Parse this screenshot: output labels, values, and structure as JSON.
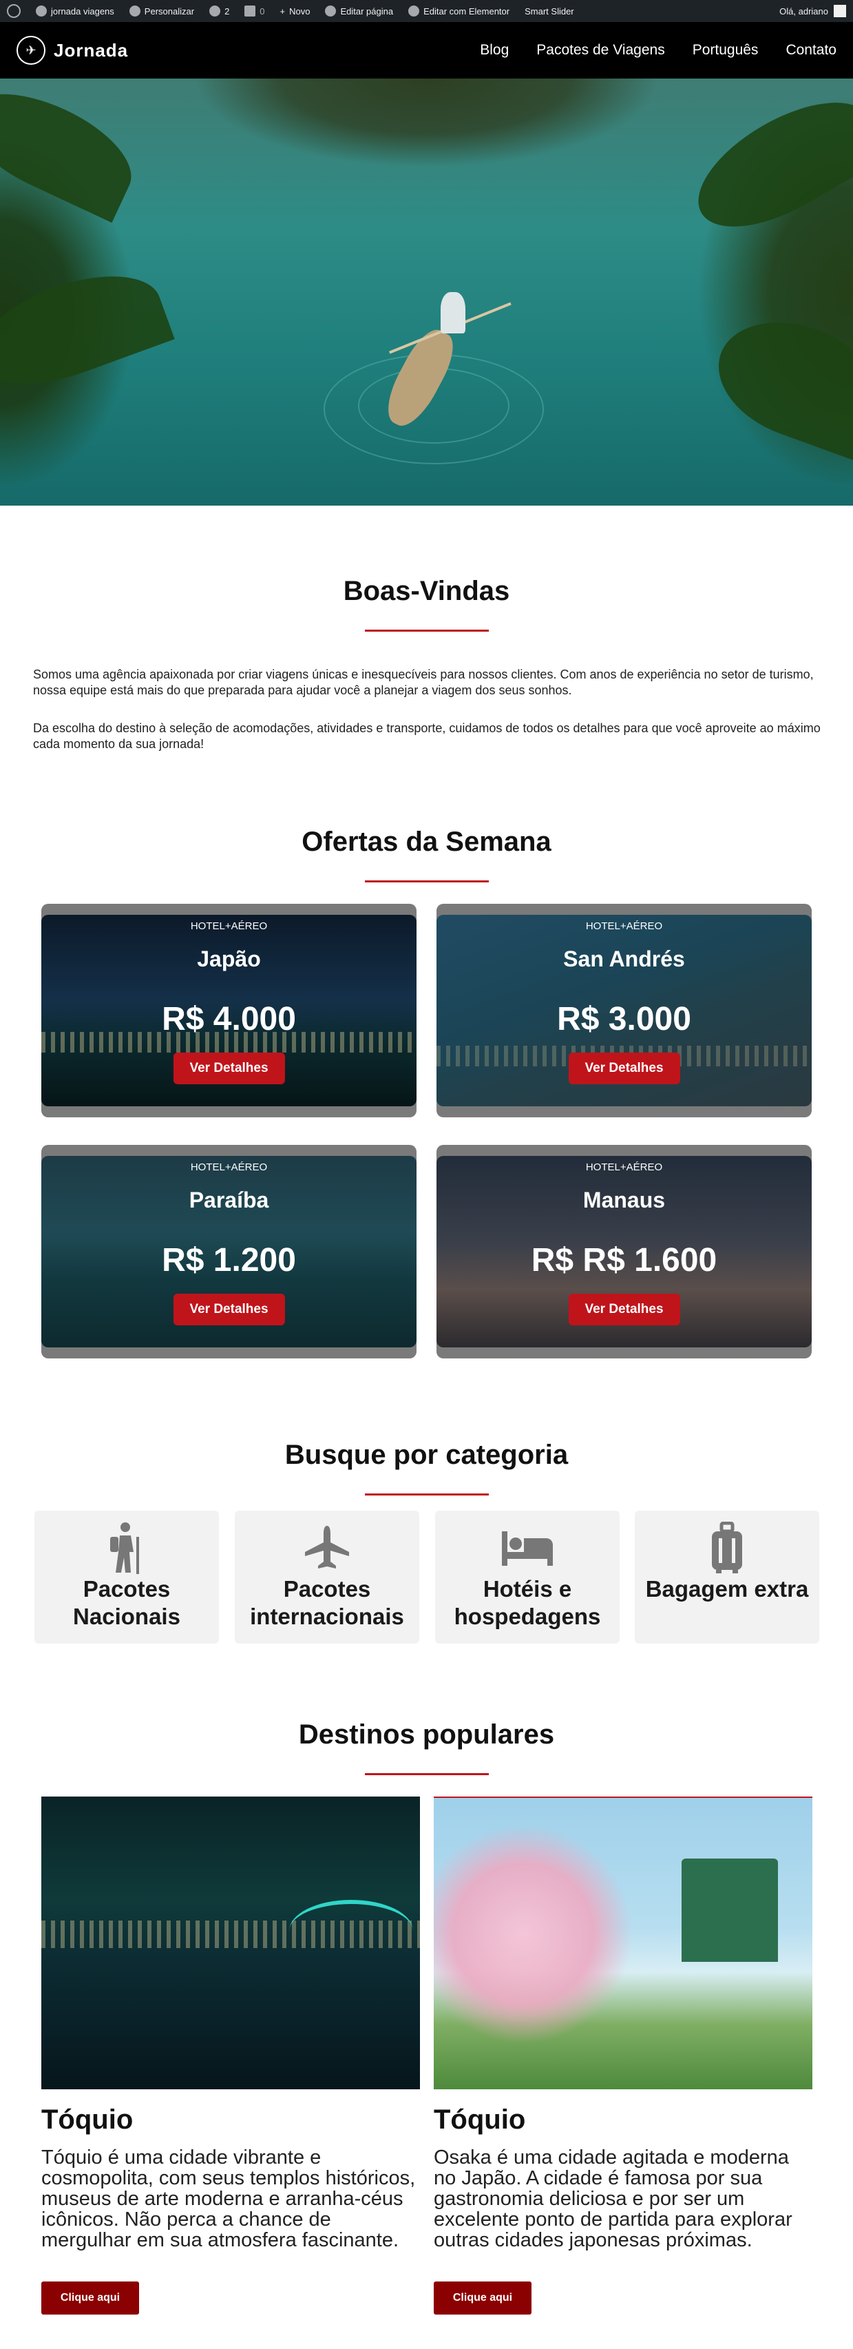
{
  "admin_bar": {
    "site_name": "jornada viagens",
    "customize": "Personalizar",
    "updates_count": "2",
    "comments_count": "0",
    "new": "Novo",
    "edit_page": "Editar página",
    "elementor": "Editar com Elementor",
    "smart_slider": "Smart Slider",
    "greeting": "Olá, adriano"
  },
  "header": {
    "logo_text": "Jornada",
    "nav": [
      "Blog",
      "Pacotes de Viagens",
      "Português",
      "Contato"
    ]
  },
  "welcome": {
    "title": "Boas-Vindas",
    "paragraph1": "Somos uma agência apaixonada por criar viagens únicas e inesquecíveis para nossos clientes. Com anos de experiência no setor de turismo, nossa equipe está mais do que preparada para ajudar você a planejar a viagem dos seus sonhos.",
    "paragraph2": "Da escolha do destino à seleção de acomodações, atividades e transporte, cuidamos de todos os detalhes para que você aproveite ao máximo cada momento da sua jornada!"
  },
  "offers": {
    "title": "Ofertas da Semana",
    "items": [
      {
        "tag": "HOTEL+AÉREO",
        "name": "Japão",
        "price": "R$ 4.000",
        "button": "Ver Detalhes"
      },
      {
        "tag": "HOTEL+AÉREO",
        "name": "San Andrés",
        "price": "R$ 3.000",
        "button": "Ver Detalhes"
      },
      {
        "tag": "HOTEL+AÉREO",
        "name": "Paraíba",
        "price": "R$ 1.200",
        "button": "Ver Detalhes"
      },
      {
        "tag": "HOTEL+AÉREO",
        "name": "Manaus",
        "price": "R$ R$ 1.600",
        "button": "Ver Detalhes"
      }
    ]
  },
  "categories": {
    "title": "Busque por categoria",
    "items": [
      {
        "label": "Pacotes Nacionais",
        "icon": "hiker-icon"
      },
      {
        "label": "Pacotes internacionais",
        "icon": "airplane-icon"
      },
      {
        "label": "Hotéis e hospedagens",
        "icon": "bed-icon"
      },
      {
        "label": "Bagagem extra",
        "icon": "luggage-icon"
      }
    ]
  },
  "destinations": {
    "title": "Destinos populares",
    "items": [
      {
        "title": "Tóquio",
        "text": "Tóquio é uma cidade vibrante e cosmopolita, com seus templos históricos, museus de arte moderna e arranha-céus icônicos. Não perca a chance de mergulhar em sua atmosfera fascinante.",
        "button": "Clique aqui"
      },
      {
        "title": "Tóquio",
        "text": "Osaka é uma cidade agitada e moderna no Japão. A cidade é famosa por sua gastronomia deliciosa e por ser um excelente ponto de partida para explorar outras cidades japonesas próximas.",
        "button": "Clique aqui"
      }
    ]
  },
  "colors": {
    "accent": "#c0141b",
    "dark_button": "#8b0000",
    "header_bg": "#000000",
    "admin_bar_bg": "#1d2327"
  }
}
